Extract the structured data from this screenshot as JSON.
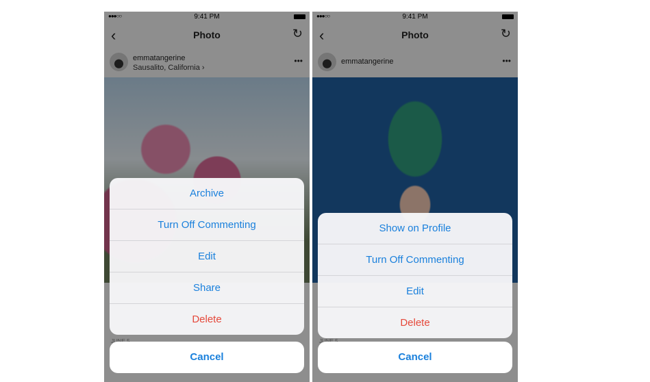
{
  "status": {
    "signal": "●●●○○",
    "time": "9:41 PM"
  },
  "left": {
    "title": "Photo",
    "username": "emmatangerine",
    "location": "Sausalito, California ›",
    "date": "JUNE 5",
    "actions": [
      "Archive",
      "Turn Off Commenting",
      "Edit",
      "Share",
      "Delete"
    ],
    "cancel": "Cancel"
  },
  "right": {
    "title": "Photo",
    "username": "emmatangerine",
    "date": "JUNE 5",
    "actions": [
      "Show on Profile",
      "Turn Off Commenting",
      "Edit",
      "Delete"
    ],
    "cancel": "Cancel"
  },
  "colors": {
    "action": "#1a80dc",
    "destructive": "#e5483a"
  },
  "icons": [
    "back-chevron-icon",
    "refresh-icon",
    "more-icon",
    "battery-icon"
  ]
}
